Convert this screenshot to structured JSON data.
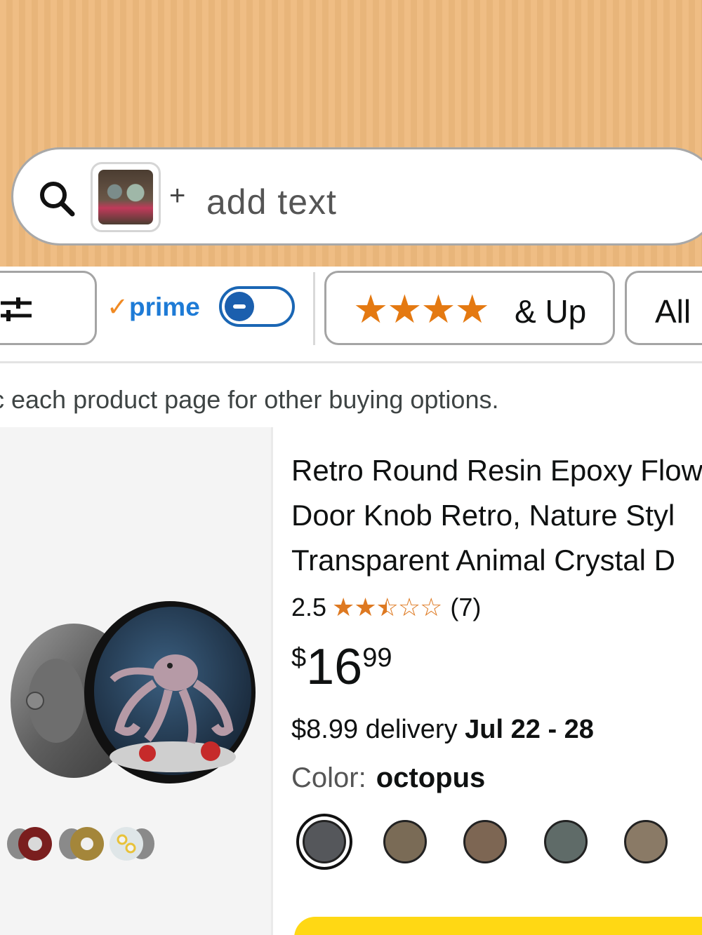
{
  "search": {
    "plus": "+",
    "text": "add text"
  },
  "filters": {
    "prime_check": "✓",
    "prime_label": "prime",
    "prime_toggle_on": true,
    "rating_stars": "★★★★",
    "rating_label": "& Up",
    "all_label": "All"
  },
  "notice": "c each product page for other buying options.",
  "product": {
    "title_lines": [
      "Retro Round Resin Epoxy Flow",
      "Door Knob Retro, Nature Styl",
      "Transparent Animal Crystal D"
    ],
    "rating": {
      "value": "2.5",
      "stars_full": "★★",
      "star_half": "★",
      "star_half_empty": "☆",
      "stars_empty": "☆☆",
      "count": "(7)"
    },
    "price": {
      "symbol": "$",
      "whole": "16",
      "fraction": "99"
    },
    "delivery": {
      "text": "$8.99 delivery",
      "date": "Jul 22 - 28"
    },
    "color": {
      "label": "Color:",
      "value": "octopus"
    },
    "swatch_colors": [
      "#55575b",
      "#7a6b56",
      "#7d6653",
      "#5f6b68",
      "#8a7a66"
    ]
  },
  "colors": {
    "accent_orange": "#e47911",
    "prime_blue": "#1e7bd6",
    "cart_yellow": "#ffd814"
  }
}
